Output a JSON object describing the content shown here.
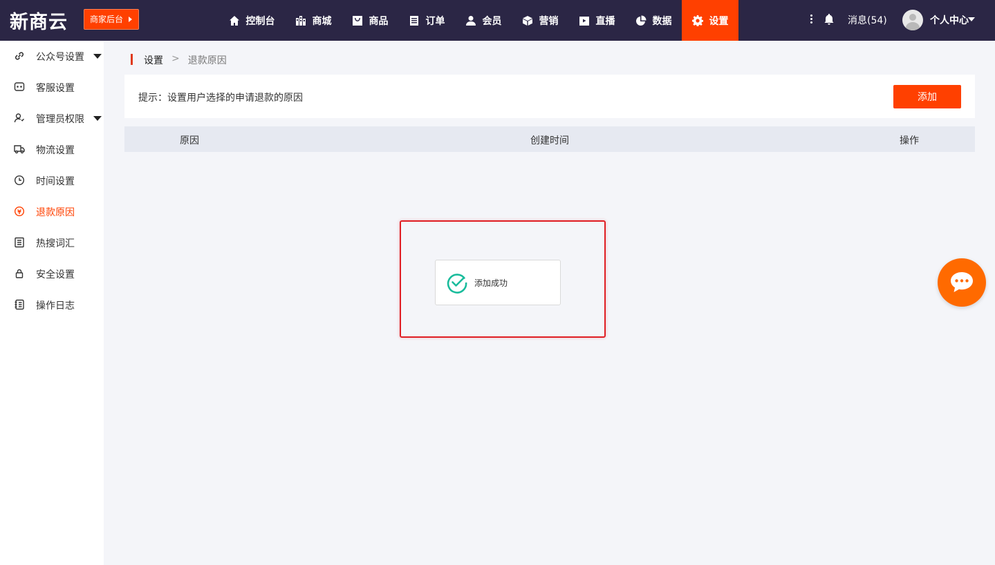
{
  "header": {
    "logo": "新商云",
    "merchant_button": "商家后台",
    "nav": [
      {
        "label": "控制台",
        "icon": "home-icon"
      },
      {
        "label": "商城",
        "icon": "building-icon"
      },
      {
        "label": "商品",
        "icon": "shopping-bag-icon"
      },
      {
        "label": "订单",
        "icon": "clipboard-icon"
      },
      {
        "label": "会员",
        "icon": "user-icon"
      },
      {
        "label": "营销",
        "icon": "cube-icon"
      },
      {
        "label": "直播",
        "icon": "play-icon"
      },
      {
        "label": "数据",
        "icon": "pie-chart-icon"
      },
      {
        "label": "设置",
        "icon": "gear-icon",
        "active": true
      }
    ],
    "messages": "消息(54)",
    "profile": "个人中心"
  },
  "sidebar": {
    "items": [
      {
        "label": "公众号设置",
        "icon": "link-icon",
        "has_submenu": true
      },
      {
        "label": "客服设置",
        "icon": "chat-box-icon"
      },
      {
        "label": "管理员权限",
        "icon": "user-permission-icon",
        "has_submenu": true
      },
      {
        "label": "物流设置",
        "icon": "truck-icon"
      },
      {
        "label": "时间设置",
        "icon": "clock-icon"
      },
      {
        "label": "退款原因",
        "icon": "refund-icon",
        "active": true
      },
      {
        "label": "热搜词汇",
        "icon": "list-icon"
      },
      {
        "label": "安全设置",
        "icon": "lock-icon"
      },
      {
        "label": "操作日志",
        "icon": "log-icon"
      }
    ]
  },
  "breadcrumb": {
    "root": "设置",
    "separator": ">",
    "current": "退款原因"
  },
  "tip": {
    "text": "提示：设置用户选择的申请退款的原因",
    "add_button": "添加"
  },
  "table": {
    "headers": [
      "原因",
      "创建时间",
      "操作"
    ]
  },
  "toast": {
    "text": "添加成功"
  },
  "colors": {
    "topbar": "#2b2645",
    "accent": "#ff4000",
    "highlight_border": "#e01e24",
    "success": "#1abc9c",
    "chat_fab": "#ff6a00"
  }
}
